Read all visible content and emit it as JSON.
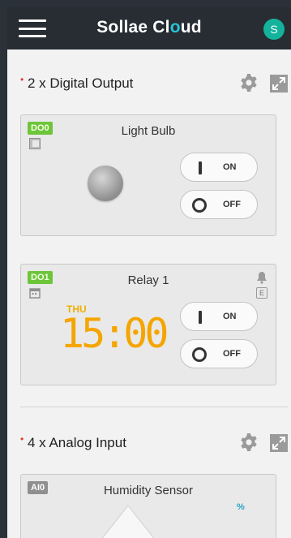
{
  "app": {
    "brand_prefix": "Sollae Cl",
    "brand_accent": "o",
    "brand_suffix": "ud",
    "avatar_letter": "S"
  },
  "sections": {
    "digital_output": {
      "bullet": "•",
      "title": "2 x Digital Output"
    },
    "analog_input": {
      "bullet": "•",
      "title": "4 x Analog Input"
    }
  },
  "cards": {
    "do0": {
      "badge": "DO0",
      "title": "Light Bulb",
      "mode_icon": "A",
      "on_label": "ON",
      "off_label": "OFF"
    },
    "do1": {
      "badge": "DO1",
      "title": "Relay 1",
      "day": "THU",
      "time": "15:00",
      "side_icon": "E",
      "on_label": "ON",
      "off_label": "OFF"
    },
    "ai0": {
      "badge": "AI0",
      "title": "Humidity Sensor",
      "unit": "%"
    }
  },
  "icons": {
    "menu": "hamburger-icon",
    "settings": "gear-icon",
    "expand": "expand-icon",
    "bell": "bell-icon",
    "calendar": "calendar-icon"
  },
  "colors": {
    "topbar": "#272d33",
    "accent": "#2ac4d7",
    "avatar": "#14b29b",
    "badge_green": "#6dc53a",
    "clock": "#f5a500",
    "bullet": "#e13a2f"
  }
}
